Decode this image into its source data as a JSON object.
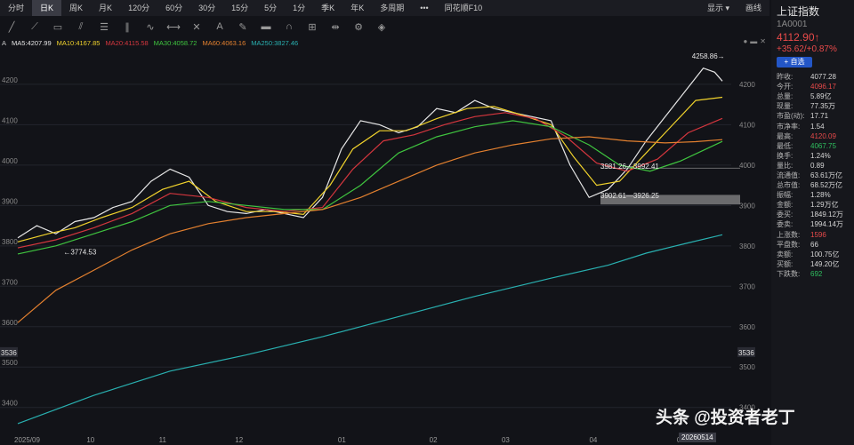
{
  "topbar": {
    "tabs": [
      "分时",
      "日K",
      "周K",
      "月K",
      "120分",
      "60分",
      "30分",
      "15分",
      "5分",
      "1分",
      "季K",
      "年K",
      "多周期",
      "•••",
      "同花顺F10"
    ],
    "active_tab": "日K",
    "right": [
      "显示",
      "画线"
    ]
  },
  "legend": {
    "prefix": "A",
    "items": [
      {
        "label": "MA5:4207.99",
        "color": "#e6e6e6"
      },
      {
        "label": "MA10:4167.85",
        "color": "#f0d22c"
      },
      {
        "label": "MA20:4115.58",
        "color": "#d4363e"
      },
      {
        "label": "MA30:4058.72",
        "color": "#3fc43f"
      },
      {
        "label": "MA60:4063.16",
        "color": "#e3802f"
      },
      {
        "label": "MA250:3827.46",
        "color": "#29b0b0"
      }
    ]
  },
  "chart_data": {
    "type": "line",
    "title": "",
    "ylim": [
      3340,
      4290
    ],
    "y_ticks": [
      4200,
      4100,
      4000,
      3900,
      3800,
      3700,
      3600,
      3500,
      3400
    ],
    "x_tick_labels": [
      "2025/09",
      "10",
      "11",
      "12",
      "01",
      "02",
      "03",
      "04",
      "05"
    ],
    "x_tick_pos": [
      0,
      19,
      38,
      58,
      85,
      109,
      128,
      151,
      174
    ],
    "n_days": 186,
    "annotations": [
      {
        "text": "4258.86→",
        "x": 177,
        "y": 4258.86
      },
      {
        "text": "←3774.53",
        "x": 12,
        "y": 3774.53
      },
      {
        "text": "3981.26—3992.41",
        "x": 153,
        "y": 3986
      },
      {
        "text": "3902.61—3926.25",
        "x": 153,
        "y": 3914
      }
    ],
    "axis_marker": {
      "label": "3536",
      "value": 3536
    },
    "gap_band": [
      3902.61,
      3926.25
    ],
    "current_line": 3992.41,
    "series": [
      {
        "name": "MA5",
        "color": "#e6e6e6",
        "points": [
          [
            0,
            3820
          ],
          [
            5,
            3850
          ],
          [
            10,
            3830
          ],
          [
            15,
            3860
          ],
          [
            20,
            3870
          ],
          [
            25,
            3895
          ],
          [
            30,
            3910
          ],
          [
            35,
            3960
          ],
          [
            40,
            3990
          ],
          [
            45,
            3970
          ],
          [
            50,
            3900
          ],
          [
            55,
            3885
          ],
          [
            60,
            3880
          ],
          [
            65,
            3890
          ],
          [
            70,
            3880
          ],
          [
            75,
            3870
          ],
          [
            80,
            3920
          ],
          [
            85,
            4040
          ],
          [
            90,
            4110
          ],
          [
            95,
            4100
          ],
          [
            100,
            4080
          ],
          [
            105,
            4095
          ],
          [
            110,
            4140
          ],
          [
            115,
            4130
          ],
          [
            120,
            4160
          ],
          [
            125,
            4140
          ],
          [
            130,
            4130
          ],
          [
            135,
            4120
          ],
          [
            140,
            4110
          ],
          [
            145,
            4000
          ],
          [
            150,
            3920
          ],
          [
            155,
            3940
          ],
          [
            160,
            3990
          ],
          [
            165,
            4060
          ],
          [
            170,
            4120
          ],
          [
            175,
            4180
          ],
          [
            180,
            4240
          ],
          [
            183,
            4230
          ],
          [
            185,
            4207.99
          ]
        ]
      },
      {
        "name": "MA10",
        "color": "#f0d22c",
        "points": [
          [
            0,
            3810
          ],
          [
            8,
            3830
          ],
          [
            15,
            3845
          ],
          [
            22,
            3870
          ],
          [
            30,
            3895
          ],
          [
            38,
            3940
          ],
          [
            45,
            3960
          ],
          [
            52,
            3910
          ],
          [
            60,
            3885
          ],
          [
            68,
            3885
          ],
          [
            75,
            3878
          ],
          [
            82,
            3950
          ],
          [
            88,
            4040
          ],
          [
            95,
            4085
          ],
          [
            102,
            4085
          ],
          [
            110,
            4115
          ],
          [
            118,
            4140
          ],
          [
            125,
            4145
          ],
          [
            132,
            4125
          ],
          [
            140,
            4100
          ],
          [
            146,
            4020
          ],
          [
            152,
            3950
          ],
          [
            158,
            3960
          ],
          [
            165,
            4030
          ],
          [
            172,
            4100
          ],
          [
            178,
            4160
          ],
          [
            185,
            4167.85
          ]
        ]
      },
      {
        "name": "MA20",
        "color": "#d4363e",
        "points": [
          [
            0,
            3795
          ],
          [
            10,
            3815
          ],
          [
            20,
            3845
          ],
          [
            30,
            3880
          ],
          [
            40,
            3930
          ],
          [
            50,
            3920
          ],
          [
            60,
            3895
          ],
          [
            70,
            3885
          ],
          [
            80,
            3895
          ],
          [
            88,
            3990
          ],
          [
            96,
            4060
          ],
          [
            104,
            4075
          ],
          [
            112,
            4100
          ],
          [
            120,
            4120
          ],
          [
            128,
            4130
          ],
          [
            136,
            4115
          ],
          [
            144,
            4070
          ],
          [
            152,
            4005
          ],
          [
            160,
            3985
          ],
          [
            168,
            4015
          ],
          [
            176,
            4080
          ],
          [
            185,
            4115.58
          ]
        ]
      },
      {
        "name": "MA30",
        "color": "#3fc43f",
        "points": [
          [
            0,
            3780
          ],
          [
            10,
            3800
          ],
          [
            20,
            3830
          ],
          [
            30,
            3860
          ],
          [
            40,
            3900
          ],
          [
            50,
            3910
          ],
          [
            60,
            3900
          ],
          [
            70,
            3890
          ],
          [
            80,
            3890
          ],
          [
            90,
            3950
          ],
          [
            100,
            4030
          ],
          [
            110,
            4070
          ],
          [
            120,
            4095
          ],
          [
            130,
            4110
          ],
          [
            140,
            4095
          ],
          [
            150,
            4050
          ],
          [
            158,
            4000
          ],
          [
            166,
            3985
          ],
          [
            174,
            4010
          ],
          [
            185,
            4058.72
          ]
        ]
      },
      {
        "name": "MA60",
        "color": "#e3802f",
        "points": [
          [
            0,
            3610
          ],
          [
            10,
            3690
          ],
          [
            20,
            3740
          ],
          [
            30,
            3790
          ],
          [
            40,
            3830
          ],
          [
            50,
            3855
          ],
          [
            60,
            3870
          ],
          [
            70,
            3880
          ],
          [
            80,
            3890
          ],
          [
            90,
            3920
          ],
          [
            100,
            3960
          ],
          [
            110,
            4000
          ],
          [
            120,
            4030
          ],
          [
            130,
            4050
          ],
          [
            140,
            4065
          ],
          [
            150,
            4070
          ],
          [
            160,
            4060
          ],
          [
            170,
            4055
          ],
          [
            178,
            4058
          ],
          [
            185,
            4063.16
          ]
        ]
      },
      {
        "name": "MA250",
        "color": "#29b0b0",
        "points": [
          [
            0,
            3360
          ],
          [
            20,
            3430
          ],
          [
            40,
            3490
          ],
          [
            60,
            3530
          ],
          [
            80,
            3575
          ],
          [
            100,
            3625
          ],
          [
            120,
            3675
          ],
          [
            140,
            3720
          ],
          [
            155,
            3752
          ],
          [
            165,
            3782
          ],
          [
            175,
            3805
          ],
          [
            185,
            3827.46
          ]
        ]
      }
    ]
  },
  "sidebar": {
    "name": "上证指数",
    "code": "1A0001",
    "price": "4112.90↑",
    "change": "+35.62/+0.87%",
    "watch": "+ 自选",
    "rows": [
      {
        "k": "昨收:",
        "v": "4077.28",
        "c": ""
      },
      {
        "k": "今开:",
        "v": "4096.17",
        "c": "red"
      },
      {
        "k": "总量:",
        "v": "5.89亿",
        "c": ""
      },
      {
        "k": "现量:",
        "v": "77.35万",
        "c": ""
      },
      {
        "k": "市盈(动):",
        "v": "17.71",
        "c": ""
      },
      {
        "k": "市净率:",
        "v": "1.54",
        "c": ""
      },
      {
        "k": "最高:",
        "v": "4120.09",
        "c": "red"
      },
      {
        "k": "最低:",
        "v": "4067.75",
        "c": "green"
      },
      {
        "k": "换手:",
        "v": "1.24%",
        "c": ""
      },
      {
        "k": "量比:",
        "v": "0.89",
        "c": ""
      },
      {
        "k": "流通值:",
        "v": "63.61万亿",
        "c": ""
      },
      {
        "k": "总市值:",
        "v": "68.52万亿",
        "c": ""
      },
      {
        "k": "振幅:",
        "v": "1.28%",
        "c": ""
      },
      {
        "k": "金额:",
        "v": "1.29万亿",
        "c": ""
      },
      {
        "k": "委买:",
        "v": "1849.12万",
        "c": ""
      },
      {
        "k": "委卖:",
        "v": "1994.14万",
        "c": ""
      },
      {
        "k": "上涨数:",
        "v": "1596",
        "c": "red"
      },
      {
        "k": "平盘数:",
        "v": "66",
        "c": ""
      },
      {
        "k": "卖额:",
        "v": "100.75亿",
        "c": ""
      },
      {
        "k": "买额:",
        "v": "149.20亿",
        "c": ""
      },
      {
        "k": "下跌数:",
        "v": "692",
        "c": "green"
      }
    ]
  },
  "watermark": "头条 @投资者老丁",
  "date_flag": "20260514"
}
